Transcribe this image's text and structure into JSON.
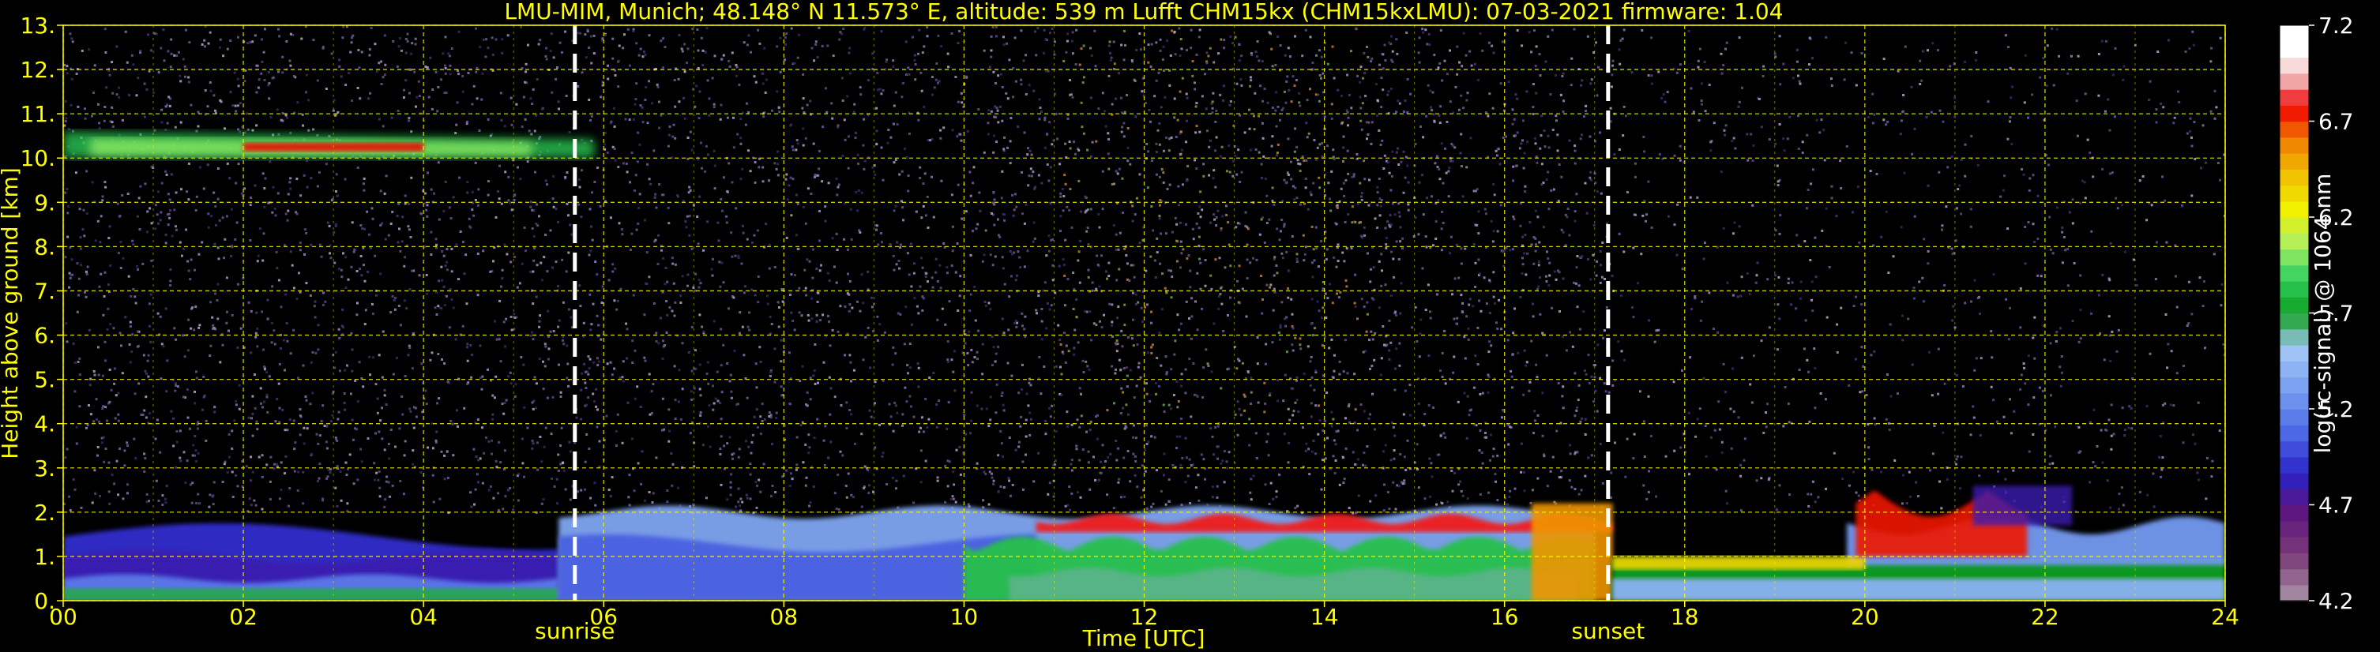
{
  "chart_data": {
    "type": "heatmap",
    "title": "LMU-MIM, Munich; 48.148° N 11.573° E, altitude: 539 m    Lufft CHM15kx (CHM15kxLMU): 07-03-2021    firmware: 1.04",
    "xlabel": "Time [UTC]",
    "ylabel": "Height above ground [km]",
    "xlim": [
      0,
      24
    ],
    "ylim": [
      0,
      13
    ],
    "xticks": [
      "00",
      "02",
      "04",
      "06",
      "08",
      "10",
      "12",
      "14",
      "16",
      "18",
      "20",
      "22",
      "24"
    ],
    "xtick_values": [
      0,
      2,
      4,
      6,
      8,
      10,
      12,
      14,
      16,
      18,
      20,
      22,
      24
    ],
    "yticks": [
      "0.",
      "1.",
      "2.",
      "3.",
      "4.",
      "5.",
      "6.",
      "7.",
      "8.",
      "9.",
      "10.",
      "11.",
      "12.",
      "13."
    ],
    "ytick_values": [
      0,
      1,
      2,
      3,
      4,
      5,
      6,
      7,
      8,
      9,
      10,
      11,
      12,
      13
    ],
    "grid": true,
    "events": [
      {
        "label": "sunrise",
        "x": 5.68
      },
      {
        "label": "sunset",
        "x": 17.15
      }
    ],
    "colorbar": {
      "label": "log(rc-signal) @ 1064 nm",
      "ticks": [
        "4.2",
        "4.7",
        "5.2",
        "5.7",
        "6.2",
        "6.7",
        "7.2"
      ],
      "tick_values": [
        4.2,
        4.7,
        5.2,
        5.7,
        6.2,
        6.7,
        7.2
      ],
      "range": [
        4.2,
        7.2
      ],
      "placement": "right"
    },
    "features": [
      {
        "name": "cirrus",
        "x": [
          0,
          5.9
        ],
        "y": [
          10.0,
          10.6
        ],
        "level": 6.0
      },
      {
        "name": "boundary-layer-morning",
        "x": [
          0,
          5.5
        ],
        "y": [
          0,
          1.8
        ],
        "level": 4.9
      },
      {
        "name": "boundary-layer-day",
        "x": [
          5.5,
          17.0
        ],
        "y": [
          0,
          2.2
        ],
        "level": 5.3
      },
      {
        "name": "cloud-tops",
        "x": [
          10.8,
          17.2
        ],
        "y": [
          1.5,
          2.1
        ],
        "level": 6.8
      },
      {
        "name": "evening-aerosol",
        "x": [
          17.2,
          24
        ],
        "y": [
          0.3,
          2.7
        ],
        "level": 5.6
      }
    ]
  },
  "colors": {
    "text": "#ffff00",
    "grid": "#ffff00",
    "background": "#000000",
    "colorbar_text": "#ffffff"
  }
}
